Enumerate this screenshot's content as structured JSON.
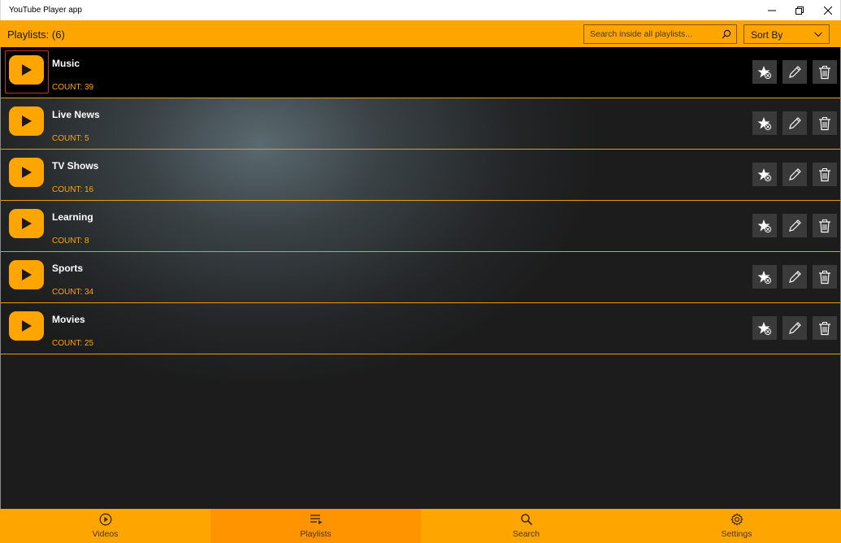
{
  "window": {
    "title": "YouTube Player app"
  },
  "header": {
    "playlists_label": "Playlists: (6)",
    "search_placeholder": "Search inside all playlists...",
    "sort_label": "Sort By"
  },
  "playlists": [
    {
      "name": "Music",
      "count": "COUNT: 39"
    },
    {
      "name": "Live News",
      "count": "COUNT: 5"
    },
    {
      "name": "TV Shows",
      "count": "COUNT: 16"
    },
    {
      "name": "Learning",
      "count": "COUNT: 8"
    },
    {
      "name": "Sports",
      "count": "COUNT: 34"
    },
    {
      "name": "Movies",
      "count": "COUNT: 25"
    }
  ],
  "nav": [
    {
      "label": "Videos",
      "icon": "play-circle-icon"
    },
    {
      "label": "Playlists",
      "icon": "playlist-icon"
    },
    {
      "label": "Search",
      "icon": "search-icon"
    },
    {
      "label": "Settings",
      "icon": "gear-icon"
    }
  ],
  "colors": {
    "accent": "#ffa500",
    "accent_active": "#ff9400",
    "action_button": "#3a3a3a"
  },
  "selected_playlist_index": 0,
  "active_nav_index": 1
}
